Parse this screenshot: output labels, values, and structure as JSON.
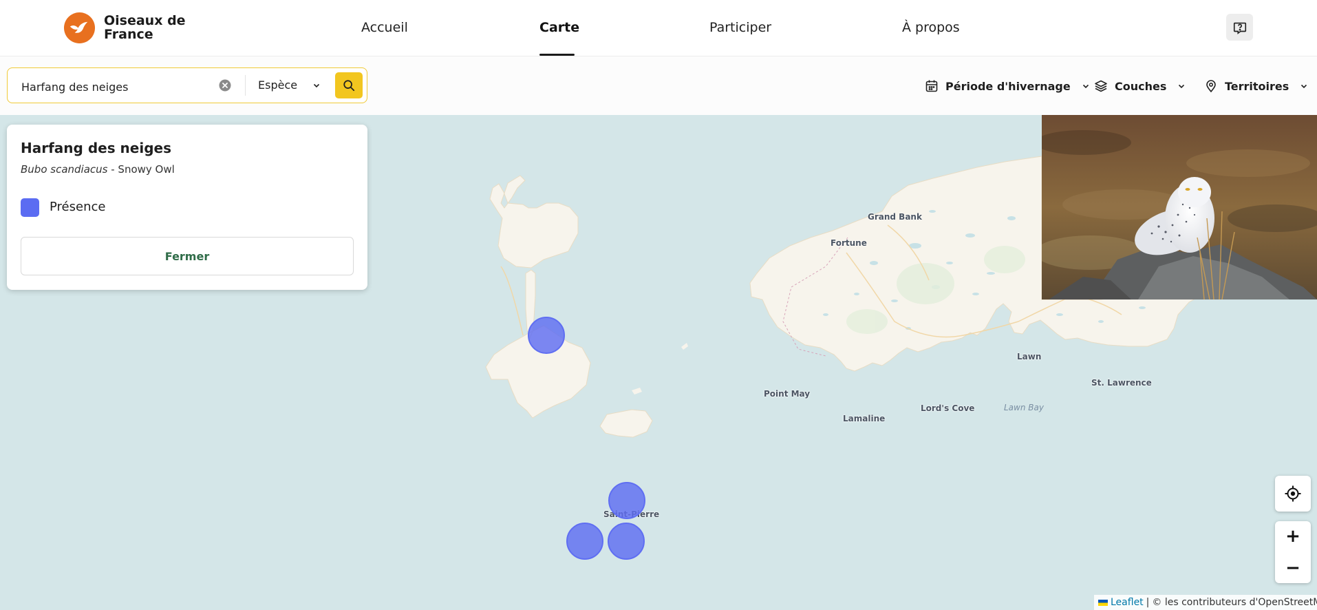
{
  "brand": {
    "line1": "Oiseaux de",
    "line2": "France"
  },
  "nav": {
    "items": [
      {
        "label": "Accueil"
      },
      {
        "label": "Carte"
      },
      {
        "label": "Participer"
      },
      {
        "label": "À propos"
      }
    ],
    "active": "Carte"
  },
  "search": {
    "value": "Harfang des neiges",
    "type_label": "Espèce"
  },
  "filters": {
    "period": "Période d'hivernage",
    "layers": "Couches",
    "territories": "Territoires"
  },
  "card": {
    "title": "Harfang des neiges",
    "latin": "Bubo scandiacus",
    "common_en": " - Snowy Owl",
    "legend": "Présence",
    "legend_color": "#5b6cf2",
    "close": "Fermer"
  },
  "map": {
    "labels": {
      "grand_bank": "Grand Bank",
      "fortune": "Fortune",
      "lawn": "Lawn",
      "st_lawrence": "St. Lawrence",
      "lawn_bay": "Lawn Bay",
      "point_may": "Point May",
      "lords_cove": "Lord's Cove",
      "lamaline": "Lamaline",
      "saint_pierre": "Saint-Pierre"
    },
    "marker_color": "#5f6ef2"
  },
  "controls": {
    "zoom_in": "+",
    "zoom_out": "−"
  },
  "attribution": {
    "leaflet": "Leaflet",
    "separator": "|",
    "text": "© les contributeurs d'OpenStreetMap"
  },
  "colors": {
    "accent": "#f2c61f",
    "brand_orange": "#e8701f",
    "close_text": "#2f6c48",
    "water": "#d4e6e8",
    "land": "#f7f4ec"
  }
}
